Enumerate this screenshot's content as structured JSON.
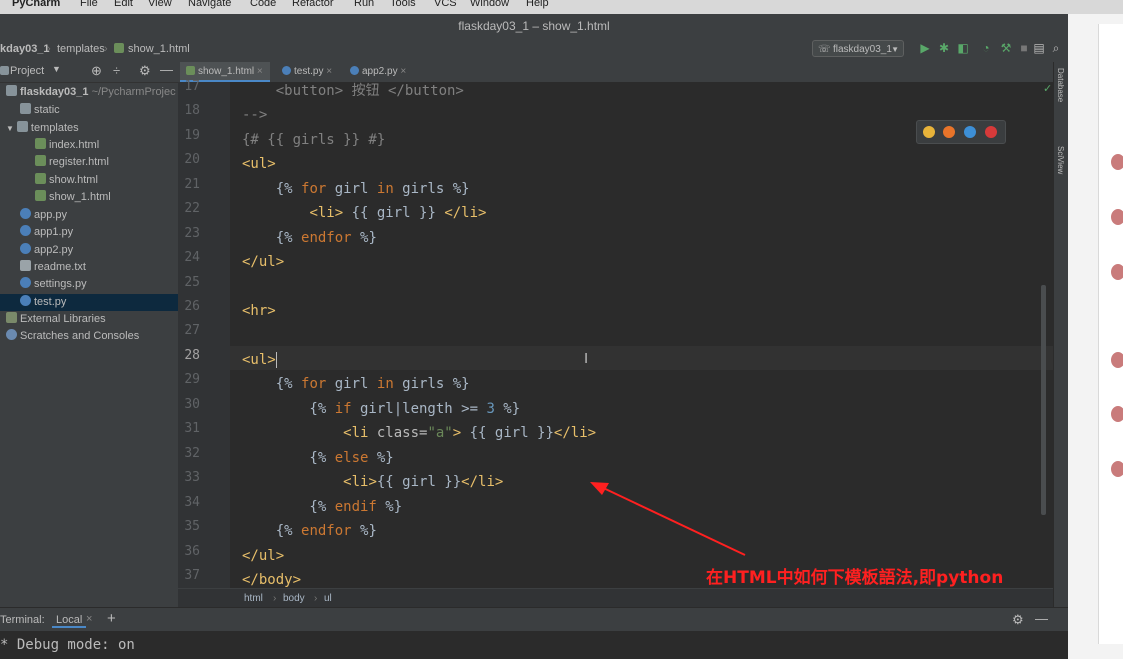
{
  "menubar": {
    "items": [
      "PyCharm",
      "File",
      "Edit",
      "View",
      "Navigate",
      "Code",
      "Refactor",
      "Run",
      "Tools",
      "VCS",
      "Window",
      "Help"
    ]
  },
  "window": {
    "title": "flaskday03_1 – show_1.html"
  },
  "breadcrumb": {
    "project": "kday03_1",
    "folder": "templates",
    "file": "show_1.html"
  },
  "run_config": "flaskday03_1",
  "sidebar": {
    "title": "Project",
    "items": [
      {
        "label": "flaskday03_1",
        "hint": "~/PycharmProjec"
      },
      {
        "label": "static"
      },
      {
        "label": "templates"
      },
      {
        "label": "index.html"
      },
      {
        "label": "register.html"
      },
      {
        "label": "show.html"
      },
      {
        "label": "show_1.html"
      },
      {
        "label": "app.py"
      },
      {
        "label": "app1.py"
      },
      {
        "label": "app2.py"
      },
      {
        "label": "readme.txt"
      },
      {
        "label": "settings.py"
      },
      {
        "label": "test.py"
      },
      {
        "label": "External Libraries"
      },
      {
        "label": "Scratches and Consoles"
      }
    ]
  },
  "tabs": [
    {
      "label": "show_1.html"
    },
    {
      "label": "test.py"
    },
    {
      "label": "app2.py"
    }
  ],
  "editor": {
    "line_numbers": [
      "17",
      "18",
      "19",
      "20",
      "21",
      "22",
      "23",
      "24",
      "25",
      "26",
      "27",
      "28",
      "29",
      "30",
      "31",
      "32",
      "33",
      "34",
      "35",
      "36",
      "37"
    ]
  },
  "statusbar": {
    "path": [
      "html",
      "body",
      "ul"
    ]
  },
  "right_tools": [
    "Database",
    "SciView"
  ],
  "terminal": {
    "title": "Terminal:",
    "tab": "Local",
    "output": " * Debug mode: on"
  },
  "annotation": {
    "text": "在HTML中如何下模板語法,即python"
  },
  "colors": {
    "accent": "#4a88c7",
    "annotation": "#ff2020",
    "background": "#2b2b2b"
  }
}
